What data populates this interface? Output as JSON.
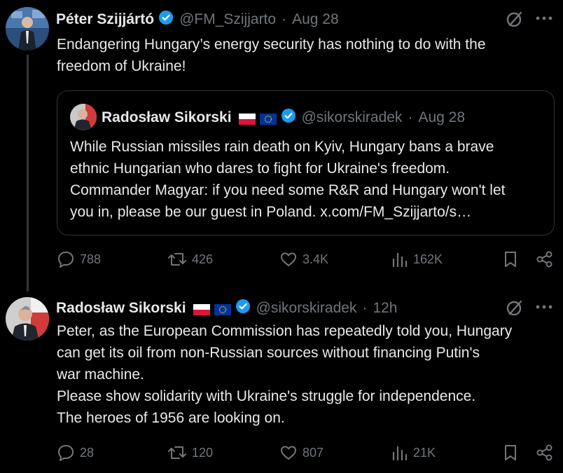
{
  "tweet1": {
    "name": "Péter Szijjártó",
    "handle": "@FM_Szijjarto",
    "sep": "·",
    "time": "Aug 28",
    "text_line1": "Endangering Hungary’s energy security has nothing to do with the",
    "text_line2": "freedom of Ukraine!",
    "quote": {
      "name": "Radosław Sikorski",
      "handle": "@sikorskiradek",
      "sep": "·",
      "time": "Aug 28",
      "line1": "While Russian missiles rain death on Kyiv, Hungary bans a brave",
      "line2": "ethnic Hungarian who dares to fight for Ukraine's freedom.",
      "line3": "Commander Magyar: if you need some R&R and Hungary won't let",
      "line4": "you in, please be our guest in Poland. x.com/FM_Szijjarto/s…"
    },
    "stats": {
      "replies": "788",
      "reposts": "426",
      "likes": "3.4K",
      "views": "162K"
    }
  },
  "tweet2": {
    "name": "Radosław Sikorski",
    "handle": "@sikorskiradek",
    "sep": "·",
    "time": "12h",
    "line1": "Peter, as the European Commission has repeatedly told you, Hungary",
    "line2": "can get its oil from non-Russian sources without financing Putin's",
    "line3": "war machine.",
    "line4": "Please show solidarity with Ukraine's struggle for independence.",
    "line5": "The heroes of 1956 are looking on.",
    "stats": {
      "replies": "28",
      "reposts": "120",
      "likes": "807",
      "views": "21K"
    }
  },
  "icons": {
    "verified": "verified-badge-icon",
    "more": "more-icon",
    "grok": "grok-icon",
    "reply": "reply-icon",
    "repost": "repost-icon",
    "like": "like-icon",
    "views": "views-icon",
    "bookmark": "bookmark-icon",
    "share": "share-icon"
  },
  "colors": {
    "background": "#000000",
    "text": "#e7e9ea",
    "muted": "#71767b",
    "verified": "#1d9bf0",
    "border": "#2f3336"
  }
}
